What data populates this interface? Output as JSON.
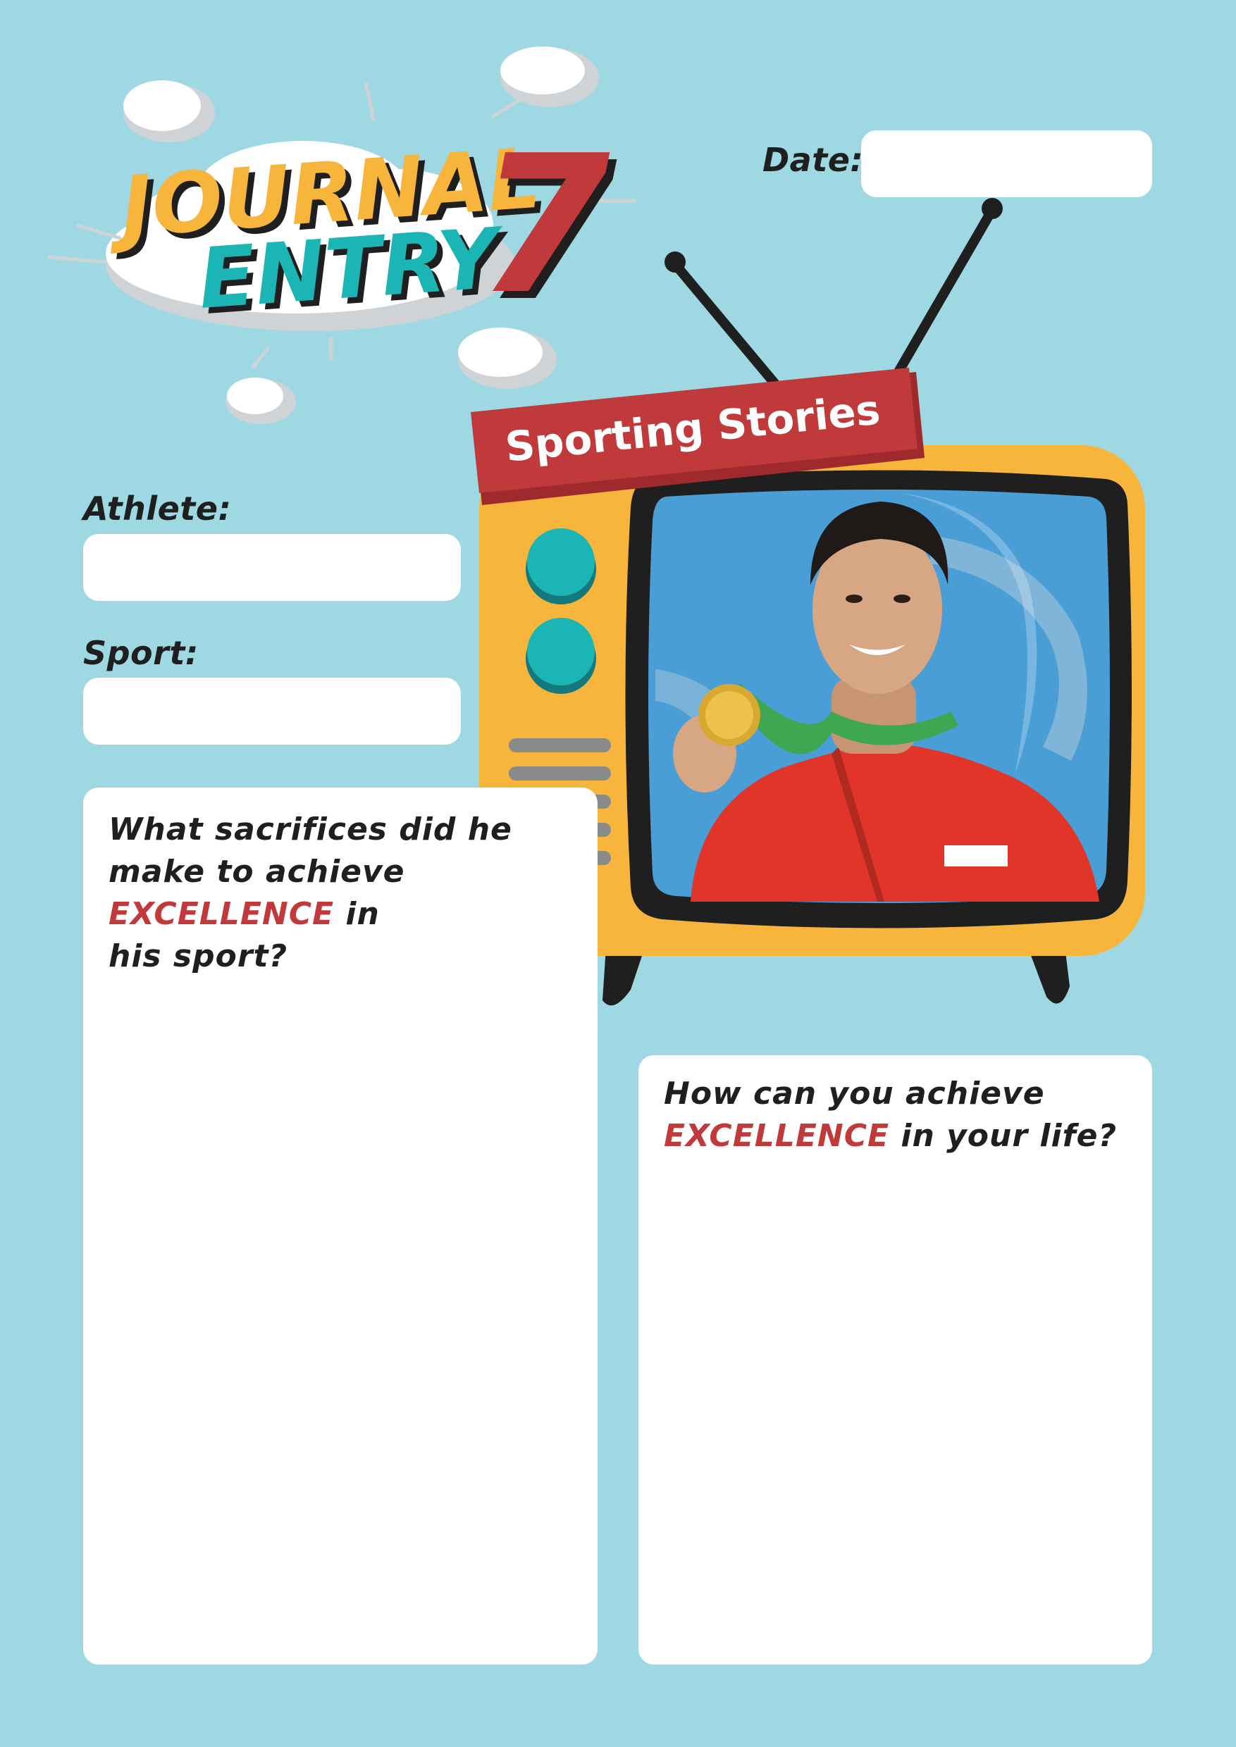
{
  "header": {
    "title_line1": "JOURNAL",
    "title_line2": "ENTRY",
    "entry_number": "7"
  },
  "date": {
    "label": "Date:",
    "value": ""
  },
  "tv": {
    "banner": "Sporting Stories"
  },
  "athlete": {
    "label": "Athlete:",
    "value": ""
  },
  "sport": {
    "label": "Sport:",
    "value": ""
  },
  "question1": {
    "line1": "What sacrifices did he",
    "line2": "make to achieve",
    "highlight": "EXCELLENCE",
    "after_highlight": " in",
    "line4": "his sport?"
  },
  "question2": {
    "line1": "How can you achieve",
    "highlight": "EXCELLENCE",
    "after_highlight": " in your life?"
  },
  "colors": {
    "background": "#9ed8e3",
    "accent_red": "#c0393b",
    "accent_yellow": "#f8b53c",
    "accent_teal": "#1cb5b5",
    "text": "#1f1f1f"
  }
}
